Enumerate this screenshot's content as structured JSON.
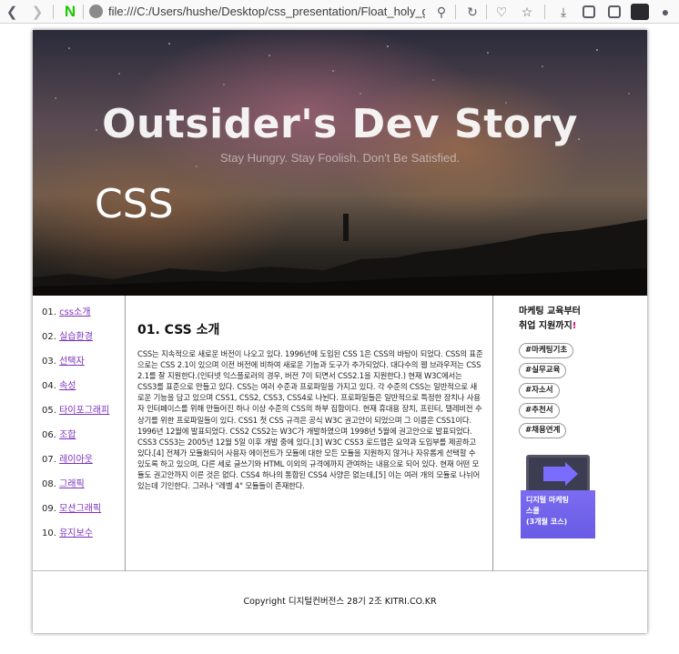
{
  "browser": {
    "url": "file:///C:/Users/hushe/Desktop/css_presentation/Float_holy_grail/",
    "logo": "N"
  },
  "header": {
    "site_title": "Outsider's Dev Story",
    "site_subtitle": "Stay Hungry. Stay Foolish. Don't Be Satisfied.",
    "page_label": "CSS"
  },
  "nav": {
    "items": [
      {
        "num": "01. ",
        "label": "css소개"
      },
      {
        "num": "02. ",
        "label": "실습환경"
      },
      {
        "num": "03. ",
        "label": "선택자"
      },
      {
        "num": "04. ",
        "label": "속성"
      },
      {
        "num": "05. ",
        "label": "타이포그래피"
      },
      {
        "num": "06. ",
        "label": "조합"
      },
      {
        "num": "07. ",
        "label": "레이아웃"
      },
      {
        "num": "08. ",
        "label": "그래픽"
      },
      {
        "num": "09. ",
        "label": "모션그래픽"
      },
      {
        "num": "10. ",
        "label": "유지보수"
      }
    ]
  },
  "main": {
    "title": "01. CSS 소개",
    "body": "CSS는 지속적으로 새로운 버전이 나오고 있다. 1996년에 도입된 CSS 1은 CSS의 바탕이 되었다. CSS의 표준으로는 CSS 2.1이 있으며 이전 버전에 비하여 새로운 기능과 도구가 추가되었다. 대다수의 웹 브라우저는 CSS 2.1를 잘 지원한다.(인터넷 익스플로러의 경우, 버전 7이 되면서 CSS2.1을 지원한다.) 현재 W3C에서는 CSS3를 표준으로 만들고 있다. CSS는 여러 수준과 프로파일을 가지고 있다. 각 수준의 CSS는 일반적으로 새로운 기능을 담고 있으며 CSS1, CSS2, CSS3, CSS4로 나뉜다. 프로파일들은 일반적으로 특정한 장치나 사용자 인터페이스를 위해 만들어진 하나 이상 수준의 CSS의 하부 집합이다. 현재 휴대용 장치, 프린터, 텔레비전 수상기를 위한 프로파일들이 있다. CSS1 첫 CSS 규격은 공식 W3C 권고안이 되었으며 그 이름은 CSS1이다. 1996년 12월에 발표되었다. CSS2 CSS2는 W3C가 개발하였으며 1998년 5월에 권고안으로 발표되었다. CSS3 CSS3는 2005년 12월 5일 이후 개발 중에 있다.[3] W3C CSS3 로드맵은 요약과 도입부를 제공하고 있다.[4] 전체가 모듈화되어 사용자 에이전트가 모듈에 대한 모든 모듈을 지원하지 않거나 자유롭게 선택할 수 있도록 하고 있으며, 다른 세로 글쓰기와 HTML 이외의 규격에까지 관여하는 내용으로 되어 있다. 현재 어떤 모듈도 권고안까지 이른 것은 없다. CSS4 하나의 통합된 CSS4 사양은 없는데,[5] 이는 여러 개의 모듈로 나뉘어 있는데 기인한다. 그러나 \"레벨 4\" 모듈들이 존재한다."
  },
  "aside": {
    "title_line1": "마케팅 교육부터",
    "title_line2": "취업 지원까지",
    "title_accent": "!",
    "tags": [
      "#마케팅기초",
      "#실무교육",
      "#자소서",
      "#추천서",
      "#채용연계"
    ],
    "ad_line1": "디지털 마케팅",
    "ad_line2": "스쿨",
    "ad_line3": "(3개월 코스)"
  },
  "footer": {
    "text": "Copyright 디지털컨버전스 28기 2조 KITRI.CO.KR"
  },
  "colors": {
    "link": "#7b2fbf",
    "accent": "#d6006f",
    "ad_bg": "#6a5be6"
  }
}
